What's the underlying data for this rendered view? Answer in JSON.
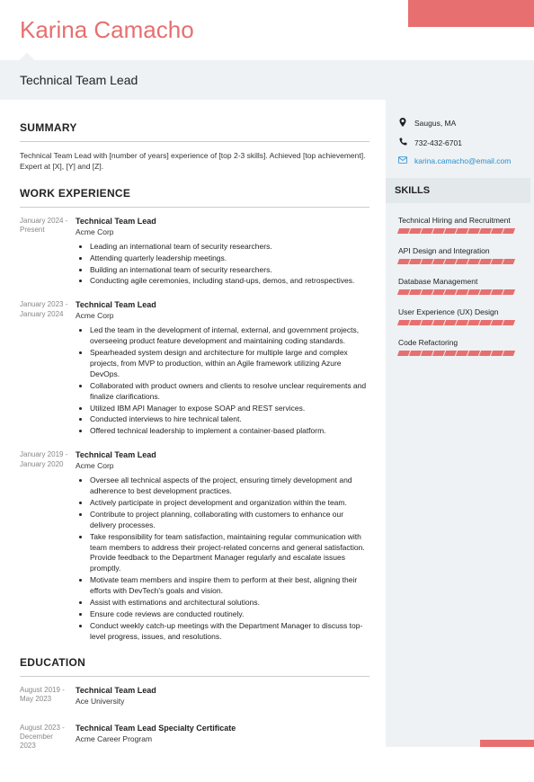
{
  "name": "Karina Camacho",
  "title": "Technical Team Lead",
  "summary_heading": "SUMMARY",
  "summary_text": "Technical Team Lead with [number of years] experience of [top 2-3 skills]. Achieved [top achievement]. Expert at [X], [Y] and [Z].",
  "work_heading": "WORK EXPERIENCE",
  "jobs": [
    {
      "dates": "January 2024 - Present",
      "title": "Technical Team Lead",
      "company": "Acme Corp",
      "bullets": [
        "Leading an international team of security researchers.",
        "Attending quarterly leadership meetings.",
        "Building an international team of security researchers.",
        "Conducting agile ceremonies, including stand-ups, demos, and retrospectives."
      ]
    },
    {
      "dates": "January 2023 - January 2024",
      "title": "Technical Team Lead",
      "company": "Acme Corp",
      "bullets": [
        "Led the team in the development of internal, external, and government projects, overseeing product feature development and maintaining coding standards.",
        "Spearheaded system design and architecture for multiple large and complex projects, from MVP to production, within an Agile framework utilizing Azure DevOps.",
        "Collaborated with product owners and clients to resolve unclear requirements and finalize clarifications.",
        "Utilized IBM API Manager to expose SOAP and REST services.",
        "Conducted interviews to hire technical talent.",
        "Offered technical leadership to implement a container-based platform."
      ]
    },
    {
      "dates": "January 2019 - January 2020",
      "title": "Technical Team Lead",
      "company": "Acme Corp",
      "bullets": [
        "Oversee all technical aspects of the project, ensuring timely development and adherence to best development practices.",
        "Actively participate in project development and organization within the team.",
        "Contribute to project planning, collaborating with customers to enhance our delivery processes.",
        "Take responsibility for team satisfaction, maintaining regular communication with team members to address their project-related concerns and general satisfaction. Provide feedback to the Department Manager regularly and escalate issues promptly.",
        "Motivate team members and inspire them to perform at their best, aligning their efforts with DevTech's goals and vision.",
        "Assist with estimations and architectural solutions.",
        "Ensure code reviews are conducted routinely.",
        "Conduct weekly catch-up meetings with the Department Manager to discuss top-level progress, issues, and resolutions."
      ]
    }
  ],
  "education_heading": "EDUCATION",
  "education": [
    {
      "dates": "August 2019 - May 2023",
      "title": "Technical Team Lead",
      "school": "Ace University"
    },
    {
      "dates": "August 2023 - December 2023",
      "title": "Technical Team Lead Specialty Certificate",
      "school": "Acme Career Program"
    }
  ],
  "contact": {
    "location": "Saugus, MA",
    "phone": "732-432-6701",
    "email": "karina.camacho@email.com"
  },
  "skills_heading": "SKILLS",
  "skills": [
    {
      "name": "Technical Hiring and Recruitment",
      "level": 10
    },
    {
      "name": "API Design and Integration",
      "level": 10
    },
    {
      "name": "Database Management",
      "level": 10
    },
    {
      "name": "User Experience (UX) Design",
      "level": 10
    },
    {
      "name": "Code Refactoring",
      "level": 10
    }
  ]
}
